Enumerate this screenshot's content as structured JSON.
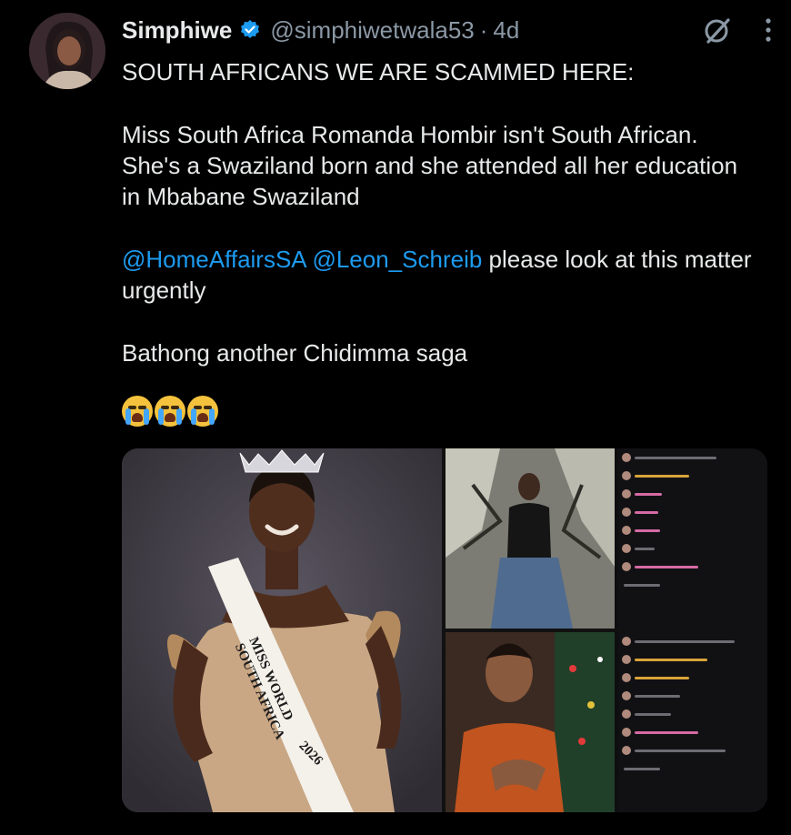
{
  "tweet": {
    "author_name": "Simphiwe",
    "handle": "@simphiwetwala53",
    "separator": "·",
    "time": "4d",
    "verified": true,
    "line1": "SOUTH AFRICANS WE ARE SCAMMED HERE:",
    "para2": "Miss South Africa Romanda Hombir isn't South African. She's a Swaziland born and she attended all her education in Mbabane Swaziland",
    "mention1": "@HomeAffairsSA",
    "mention2": "@Leon_Schreib",
    "para3_rest": " please look at this matter urgently",
    "para4": "Bathong another Chidimma saga",
    "emoji_count": 3,
    "emoji_name": "loudly-crying-face"
  },
  "media": {
    "sash_line1": "MISS WORLD",
    "sash_line2": "SOUTH AFRICA",
    "sash_year": "2026"
  },
  "colors": {
    "background": "#000000",
    "text": "#e7e9ea",
    "secondary": "#8b98a5",
    "link": "#1d9bf0",
    "verified": "#1d9bf0"
  },
  "icons": {
    "verified": "verified-badge-icon",
    "grok": "grok-icon",
    "more": "more-icon"
  }
}
